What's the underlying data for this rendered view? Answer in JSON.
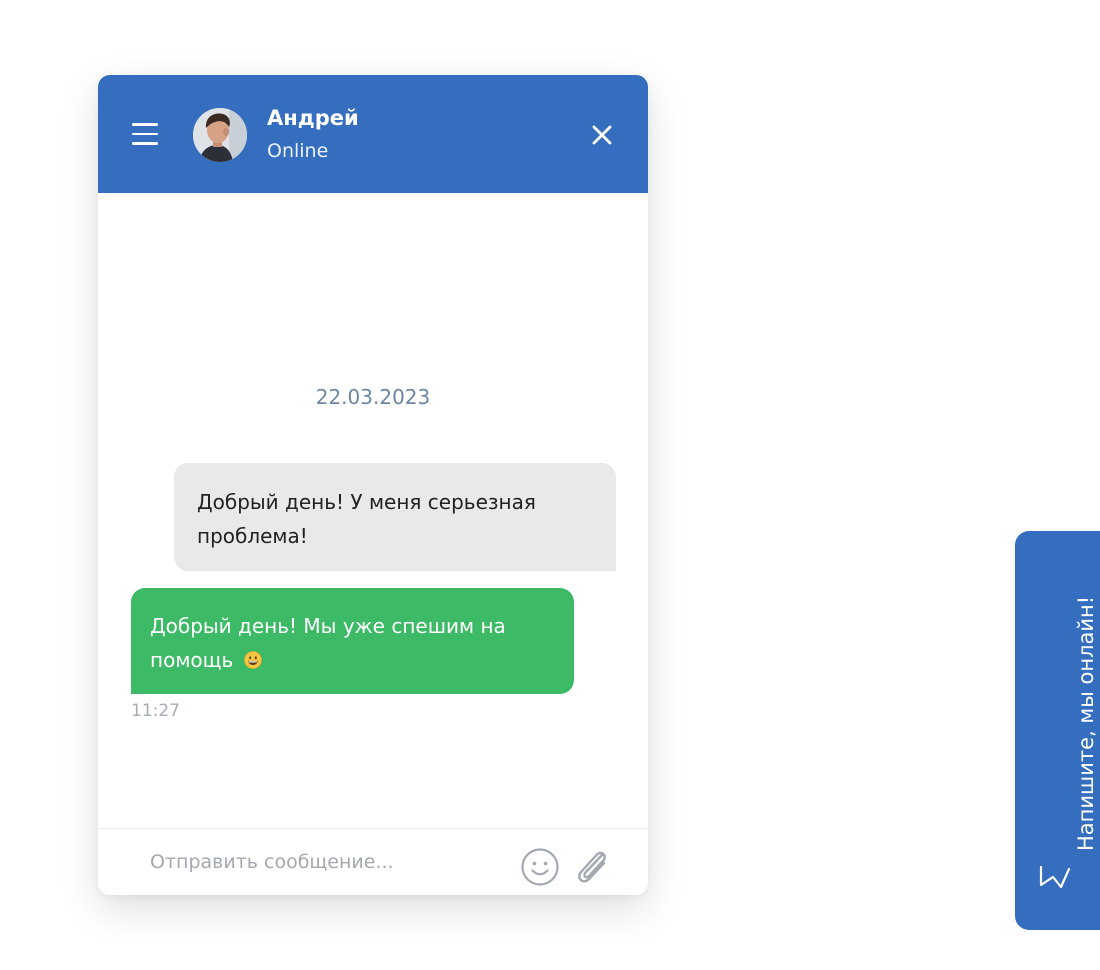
{
  "chat": {
    "contact_name": "Андрей",
    "contact_status": "Online",
    "date": "22.03.2023",
    "messages": [
      {
        "direction": "incoming",
        "text": "Добрый день! У меня серьезная проблема!"
      },
      {
        "direction": "outgoing",
        "text": "Добрый день! Мы уже спешим на помощь",
        "emoji": "grinning-face",
        "time": "11:27"
      }
    ],
    "composer_placeholder": "Отправить сообщение..."
  },
  "side_tab": {
    "label": "Напишите, мы онлайн!",
    "icon": "lightning-icon"
  },
  "icons": {
    "menu": "hamburger-icon",
    "close": "close-icon",
    "emoji": "smiley-icon",
    "attach": "paperclip-icon"
  },
  "colors": {
    "header": "#356dbf",
    "incoming_bubble": "#e9e9ea",
    "outgoing_bubble": "#3dba66",
    "date_text": "#6d86a3",
    "time_text": "#a7adb6"
  }
}
